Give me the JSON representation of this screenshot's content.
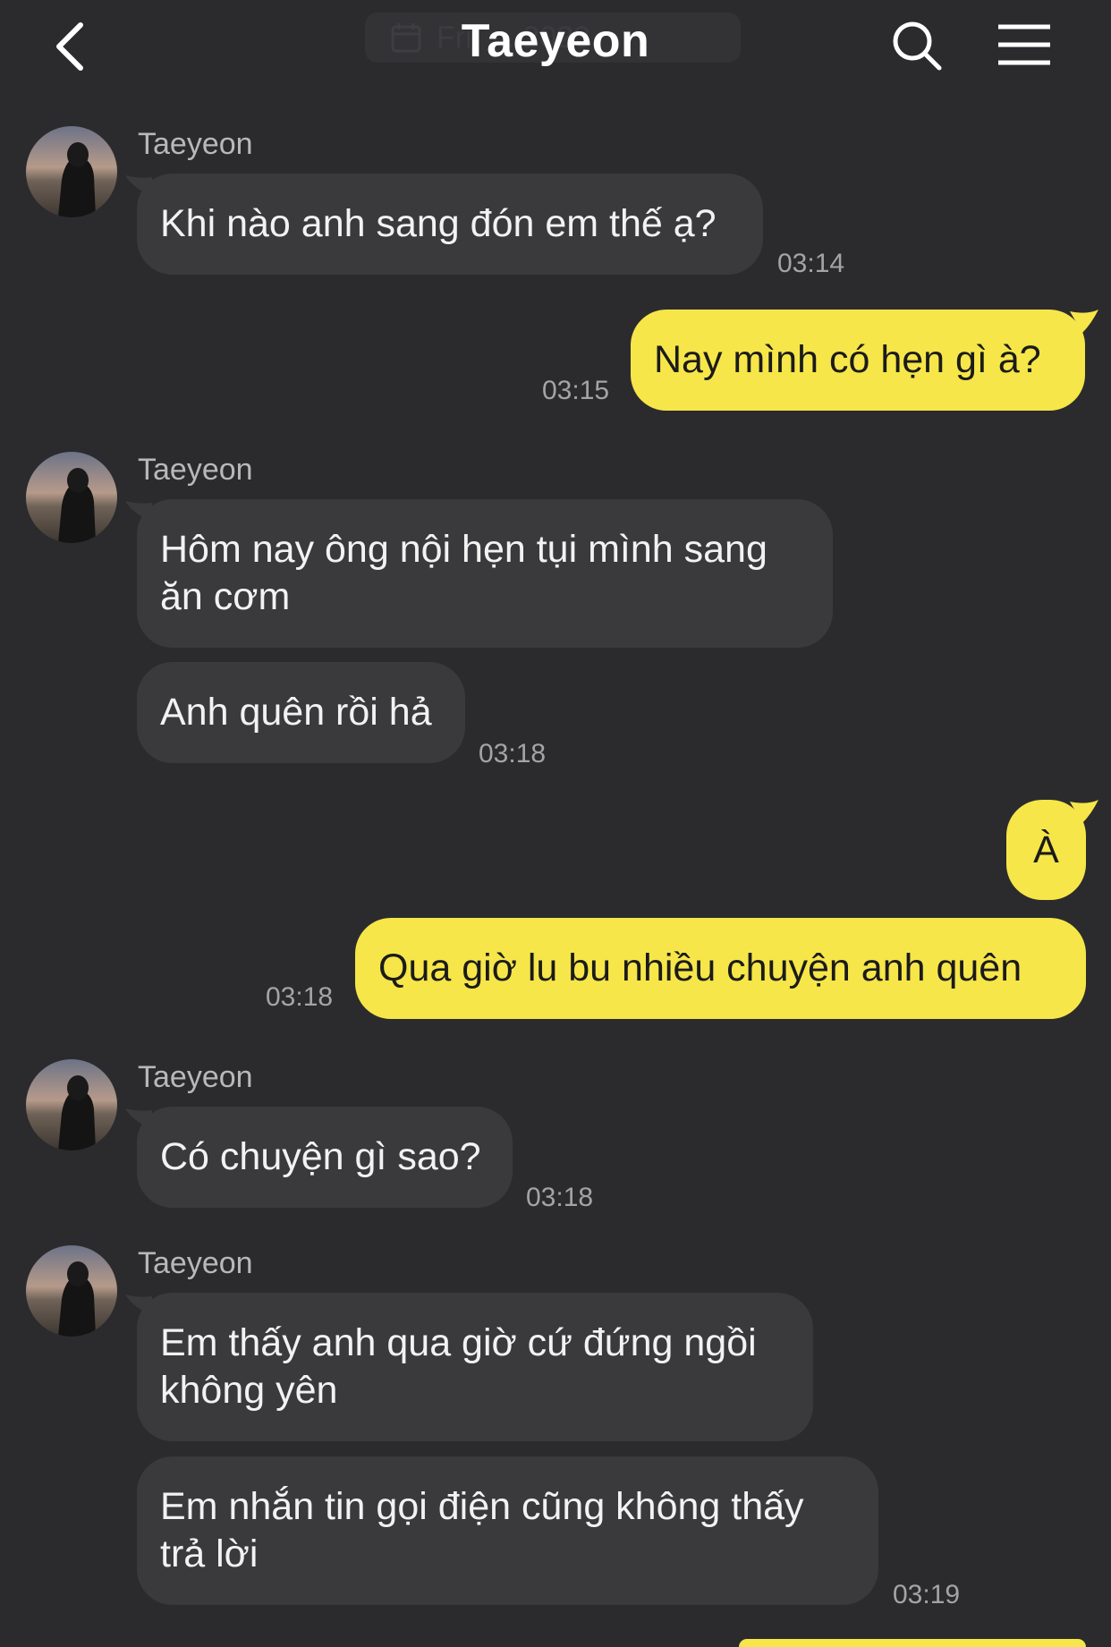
{
  "header": {
    "title": "Taeyeon",
    "date_pill": "Fri, ... 2023"
  },
  "messages": [
    {
      "sender": "Taeyeon",
      "text": "Khi nào anh sang đón em thế ạ?",
      "time": "03:14"
    },
    {
      "text": "Nay mình có hẹn gì à?",
      "time": "03:15"
    },
    {
      "sender": "Taeyeon",
      "text": "Hôm nay ông nội hẹn tụi mình sang\năn cơm"
    },
    {
      "text": "Anh quên rồi hả",
      "time": "03:18"
    },
    {
      "text": "À"
    },
    {
      "text": "Qua giờ lu bu nhiều chuyện anh quên",
      "time": "03:18"
    },
    {
      "sender": "Taeyeon",
      "text": "Có chuyện gì sao?",
      "time": "03:18"
    },
    {
      "sender": "Taeyeon",
      "text": "Em thấy anh qua giờ cứ đứng ngồi\nkhông yên"
    },
    {
      "text": "Em nhắn tin gọi điện cũng không thấy\ntrả lời",
      "time": "03:19"
    }
  ],
  "colors": {
    "background": "#2b2b2e",
    "incoming_bubble": "#3a3a3d",
    "outgoing_bubble": "#f6e649"
  }
}
